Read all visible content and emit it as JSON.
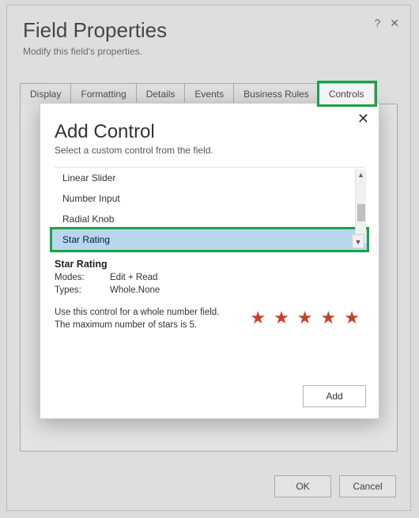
{
  "dialog": {
    "title": "Field Properties",
    "subtitle": "Modify this field's properties.",
    "tabs": [
      "Display",
      "Formatting",
      "Details",
      "Events",
      "Business Rules",
      "Controls"
    ],
    "buttons": {
      "ok": "OK",
      "cancel": "Cancel"
    }
  },
  "modal": {
    "title": "Add Control",
    "subtitle": "Select a custom control from the field.",
    "items": [
      "Linear Slider",
      "Number Input",
      "Radial Knob",
      "Star Rating"
    ],
    "selected": "Star Rating",
    "detail": {
      "name": "Star Rating",
      "modes_label": "Modes:",
      "modes_value": "Edit + Read",
      "types_label": "Types:",
      "types_value": "Whole.None",
      "desc1": "Use this control for a whole number field.",
      "desc2": "The maximum number of stars is 5."
    },
    "add": "Add"
  }
}
